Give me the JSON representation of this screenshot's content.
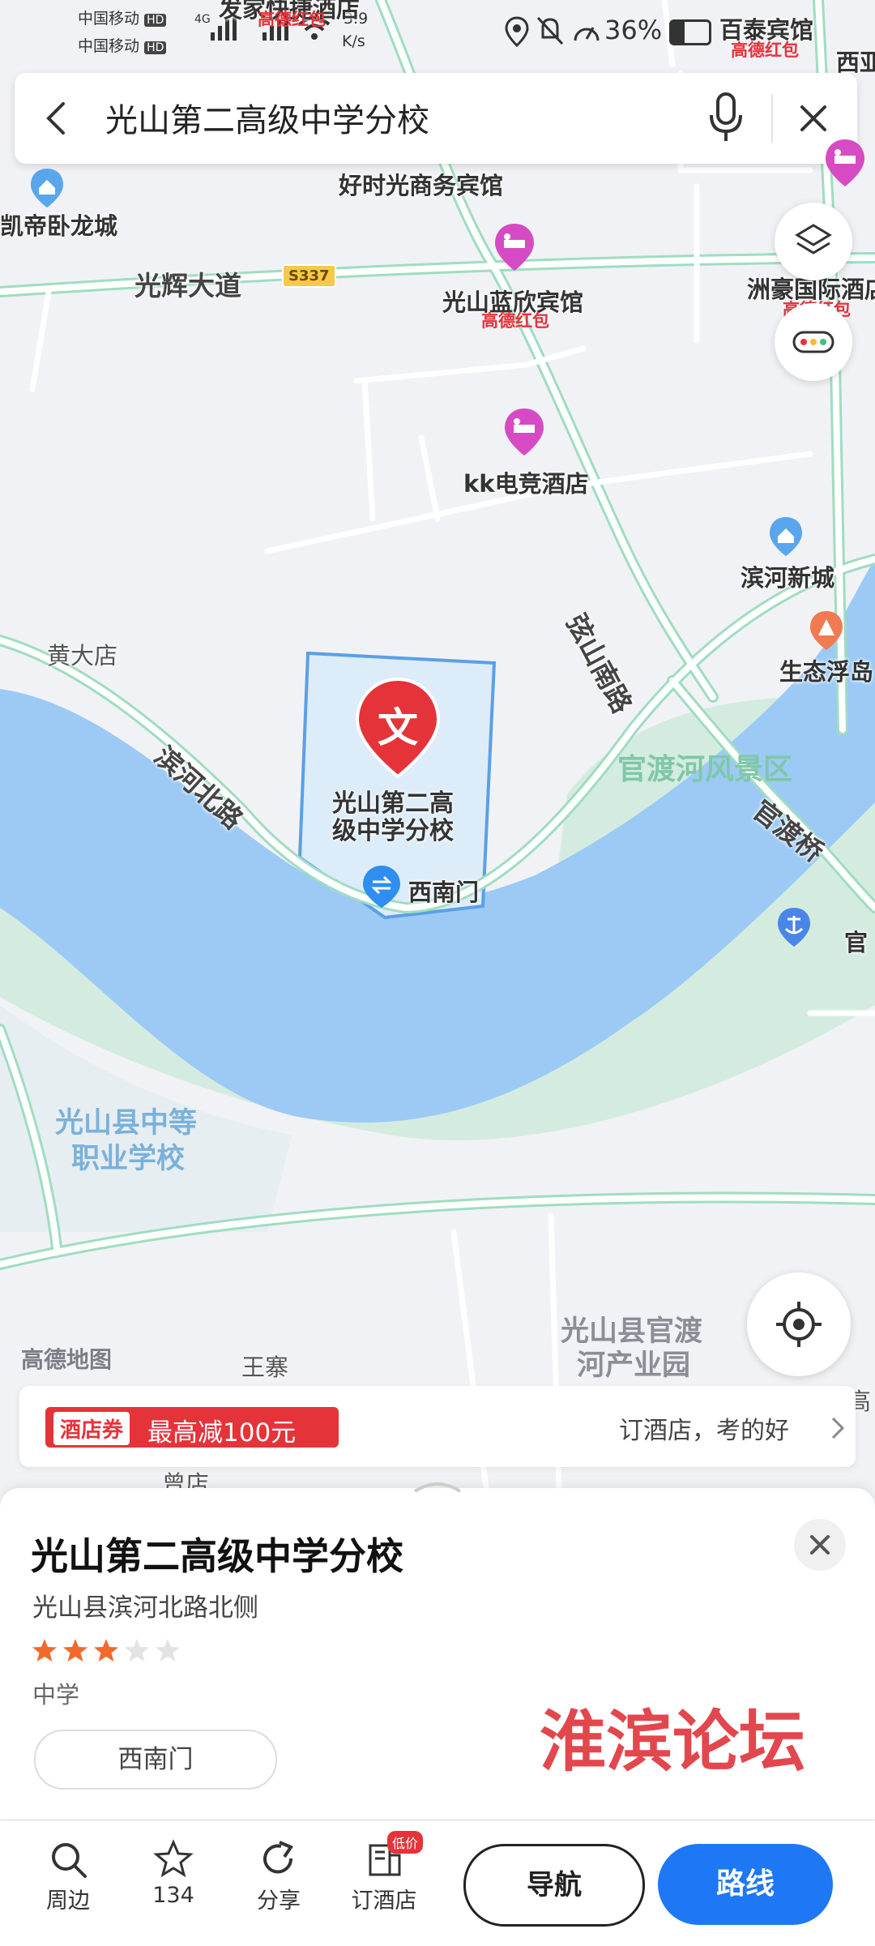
{
  "status_bar": {
    "carrier1": "中国移动",
    "carrier2": "中国移动",
    "hd": "HD",
    "net": "4G",
    "speed_value": "3.9",
    "speed_unit": "K/s",
    "battery": "36%"
  },
  "search": {
    "query": "光山第二高级中学分校"
  },
  "map": {
    "labels": {
      "top_hotel": "发家快捷酒店",
      "top_hotel_sub": "高德红包",
      "baitai": "百泰宾馆",
      "baitai_sub": "高德红包",
      "xiya": "西亚",
      "kaidi": "凯帝卧龙城",
      "haoshiguang": "好时光商务宾馆",
      "guanghui_road": "光辉大道",
      "s337": "S337",
      "lanxin": "光山蓝欣宾馆",
      "lanxin_sub": "高德红包",
      "zhouhao": "洲豪国际酒店",
      "zhouhao_sub": "高德红包",
      "kk": "kk电竞酒店",
      "binhe_xincheng": "滨河新城",
      "xianshan_road": "弦山南路",
      "shengtai": "生态浮岛",
      "huangdadian": "黄大店",
      "binhe_north_road": "滨河北路",
      "school_line1": "光山第二高",
      "school_line2": "级中学分校",
      "school_pin_char": "文",
      "xinanmen": "西南门",
      "guandu_scenic": "官渡河风景区",
      "guandu_bridge": "官渡桥",
      "guan": "官",
      "vocational_line1": "光山县中等",
      "vocational_line2": "职业学校",
      "amap": "高德地图",
      "wangzhai": "王寨",
      "industrial_line1": "光山县官渡",
      "industrial_line2": "河产业园",
      "gao": "高",
      "zengdian": "曾店"
    }
  },
  "promo": {
    "tag": "酒店券",
    "discount": "最高减100元",
    "cta": "订酒店，考的好"
  },
  "place": {
    "name": "光山第二高级中学分校",
    "address": "光山县滨河北路北侧",
    "rating": 3,
    "rating_max": 5,
    "category": "中学",
    "entrance_chip": "西南门"
  },
  "watermark": "淮滨论坛",
  "bottom_bar": {
    "nearby": "周边",
    "favorites_count": "134",
    "share": "分享",
    "book_hotel": "订酒店",
    "book_hotel_badge": "低价",
    "navigate": "导航",
    "route": "路线"
  },
  "colors": {
    "water": "#9ccaf5",
    "park": "#d4ecdf",
    "road_green": "#9fddc0",
    "brand_blue": "#1e78f5",
    "pin_red": "#e5333a",
    "hotel_magenta": "#d64bc4",
    "star": "#f06a2b"
  }
}
